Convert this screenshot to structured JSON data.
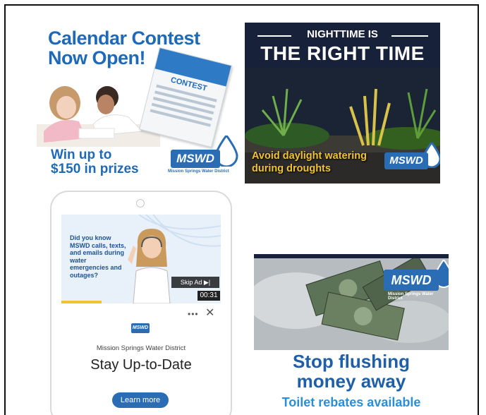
{
  "ad_calendar": {
    "title_line1": "Calendar Contest",
    "title_line2": "Now Open!",
    "flyer_title": "CONTEST",
    "prize_line1": "Win up to",
    "prize_line2": "$150 in prizes",
    "logo": "MSWD",
    "logo_sub": "Mission Springs Water District"
  },
  "ad_night": {
    "line1": "NIGHTTIME IS",
    "line2": "THE RIGHT TIME",
    "caption_line1": "Avoid daylight watering",
    "caption_line2": "during droughts",
    "logo": "MSWD"
  },
  "ad_video": {
    "question": "Did you know MSWD calls, texts, and emails during water emergencies and outages?",
    "skip_label": "Skip Ad",
    "time": "00:31",
    "progress": 0.25,
    "more_label": "•••",
    "close_label": "✕",
    "mini_logo": "MSWD",
    "organization": "Mission Springs Water District",
    "headline": "Stay Up-to-Date",
    "cta": "Learn more"
  },
  "ad_flush": {
    "logo": "MSWD",
    "logo_sub": "Mission Springs Water District",
    "headline_line1": "Stop flushing",
    "headline_line2": "money away",
    "subline": "Toilet rebates available"
  },
  "colors": {
    "brand_blue": "#2a6db5",
    "title_blue": "#1f6ab8",
    "caption_yellow": "#f2c230",
    "night_bg": "#17213a"
  }
}
